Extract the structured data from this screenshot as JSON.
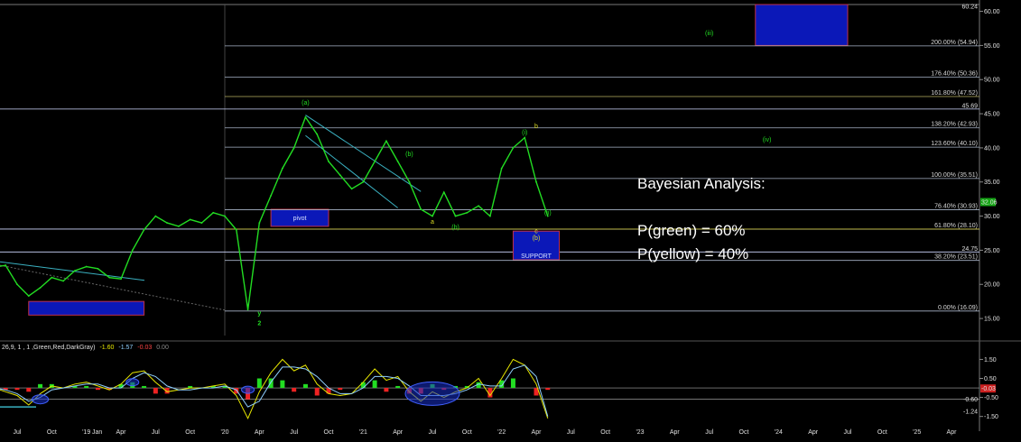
{
  "chart_data": [
    {
      "type": "line",
      "chart": "price",
      "y_axis": {
        "ylim": [
          12.5,
          61.0
        ],
        "ticks": [
          "60.00",
          "55.00",
          "50.00",
          "45.00",
          "40.00",
          "35.00",
          "30.00",
          "25.00",
          "20.00",
          "15.00"
        ],
        "tick_values": [
          60,
          55,
          50,
          45,
          40,
          35,
          30,
          25,
          20,
          15
        ],
        "price_tags": [
          {
            "text": "60.24",
            "value": 60.24
          },
          {
            "text": "45.69",
            "value": 45.69
          },
          {
            "text": "32.06",
            "value": 32.06
          },
          {
            "text": "24.75",
            "value": 24.75
          }
        ]
      },
      "x_axis": {
        "ticks": [
          "Jul",
          "Oct",
          "'19",
          "Jan",
          "Apr",
          "Jul",
          "Oct",
          "'20",
          "Apr",
          "Jul",
          "Oct",
          "'21",
          "Apr",
          "Jul",
          "Oct",
          "'22",
          "Apr",
          "Jul",
          "Oct",
          "'23",
          "Apr",
          "Jul",
          "Oct",
          "'24",
          "Apr",
          "Jul",
          "Oct",
          "'25",
          "Apr"
        ],
        "tick_dates": [
          "2018-07",
          "2018-10",
          "2019-01",
          "2019-01",
          "2019-04",
          "2019-07",
          "2019-10",
          "2020-01",
          "2020-04",
          "2020-07",
          "2020-10",
          "2021-01",
          "2021-04",
          "2021-07",
          "2021-10",
          "2022-01",
          "2022-04",
          "2022-07",
          "2022-10",
          "2023-01",
          "2023-04",
          "2023-07",
          "2023-10",
          "2024-01",
          "2024-04",
          "2024-07",
          "2024-10",
          "2025-01",
          "2025-04"
        ]
      },
      "series": [
        {
          "color": "#22dd22",
          "x": [
            "2018-05",
            "2018-06",
            "2018-07",
            "2018-08",
            "2018-09",
            "2018-10",
            "2018-11",
            "2018-12",
            "2019-01",
            "2019-02",
            "2019-03",
            "2019-04",
            "2019-05",
            "2019-06",
            "2019-07",
            "2019-08",
            "2019-09",
            "2019-10",
            "2019-11",
            "2019-12",
            "2020-01",
            "2020-02",
            "2020-03",
            "2020-04",
            "2020-05",
            "2020-06",
            "2020-07",
            "2020-08",
            "2020-09",
            "2020-10",
            "2020-11",
            "2020-12",
            "2021-01",
            "2021-02",
            "2021-03",
            "2021-04",
            "2021-05",
            "2021-06",
            "2021-07",
            "2021-08",
            "2021-09",
            "2021-10",
            "2021-11",
            "2021-12",
            "2022-01",
            "2022-02",
            "2022-03",
            "2022-04",
            "2022-05"
          ],
          "y": [
            22.5,
            22.8,
            20.0,
            18.3,
            19.5,
            21.0,
            20.5,
            22.0,
            22.6,
            22.3,
            21.0,
            20.8,
            25.0,
            28.0,
            30.0,
            29.0,
            28.5,
            29.5,
            29.0,
            30.5,
            30.0,
            28.0,
            16.3,
            29.0,
            33.0,
            37.0,
            40.0,
            44.5,
            42.0,
            38.0,
            36.0,
            34.0,
            35.0,
            38.0,
            41.0,
            38.0,
            35.0,
            31.0,
            30.0,
            33.5,
            30.0,
            30.5,
            31.5,
            30.0,
            37.0,
            40.0,
            41.5,
            35.0,
            30.0
          ]
        }
      ],
      "fib_levels": [
        {
          "label": "200.00% (54.94)",
          "value": 54.94
        },
        {
          "label": "176.40% (50.36)",
          "value": 50.36
        },
        {
          "label": "161.80% (47.52)",
          "value": 47.52
        },
        {
          "label": "138.20% (42.93)",
          "value": 42.93
        },
        {
          "label": "123.60% (40.10)",
          "value": 40.1
        },
        {
          "label": "100.00% (35.51)",
          "value": 35.51
        },
        {
          "label": "76.40% (30.93)",
          "value": 30.93
        },
        {
          "label": "61.80% (28.10)",
          "value": 28.1
        },
        {
          "label": "38.20% (23.51)",
          "value": 23.51
        },
        {
          "label": "0.00% (16.09)",
          "value": 16.09
        }
      ],
      "wave_labels": [
        {
          "text": "(a)",
          "x": "2020-08",
          "y": 46.3,
          "color": "#22dd22"
        },
        {
          "text": "(b)",
          "x": "2021-05",
          "y": 38.8,
          "color": "#22dd22"
        },
        {
          "text": "(i)",
          "x": "2022-03",
          "y": 42.0,
          "color": "#22dd22"
        },
        {
          "text": "b",
          "x": "2022-04",
          "y": 42.9,
          "color": "#dddd22"
        },
        {
          "text": "(ii)",
          "x": "2022-05",
          "y": 30.2,
          "color": "#22dd22"
        },
        {
          "text": "a",
          "x": "2021-07",
          "y": 28.9,
          "color": "#dddd22"
        },
        {
          "text": "(b)",
          "x": "2021-09",
          "y": 28.1,
          "color": "#22dd22"
        },
        {
          "text": "c",
          "x": "2022-04",
          "y": 27.5,
          "color": "#dddd22"
        },
        {
          "text": "(b)",
          "x": "2022-04",
          "y": 26.5,
          "color": "#dddd22"
        },
        {
          "text": "(iii)",
          "x": "2023-07",
          "y": 56.5,
          "color": "#22dd22"
        },
        {
          "text": "(iv)",
          "x": "2023-12",
          "y": 40.9,
          "color": "#22dd22"
        },
        {
          "text": "y",
          "x": "2020-04",
          "y": 15.5,
          "color": "#22dd22"
        },
        {
          "text": "2",
          "x": "2020-04",
          "y": 14.0,
          "color": "#22dd22"
        }
      ],
      "zones": [
        {
          "label": "pivot",
          "x0": "2020-05",
          "x1": "2020-10",
          "y0": 28.5,
          "y1": 31.0
        },
        {
          "label": "SUPPORT",
          "x0": "2022-02",
          "x1": "2022-06",
          "y0": 23.6,
          "y1": 27.8
        },
        {
          "label": "",
          "x0": "2023-11",
          "x1": "2024-07",
          "y0": 55.0,
          "y1": 61.0
        },
        {
          "label": "",
          "x0": "2018-08",
          "x1": "2019-06",
          "y0": 15.5,
          "y1": 17.5
        }
      ],
      "annotation": {
        "title": "Bayesian Analysis:",
        "lines": [
          "P(green) = 60%",
          "P(yellow) = 40%"
        ]
      }
    },
    {
      "type": "line",
      "chart": "indicator",
      "settings": {
        "text": "26,9, 1 , 1 ,Green,Red,DarkGray)",
        "values": [
          {
            "text": "-1.60",
            "color": "#e8e800"
          },
          {
            "text": "-1.57",
            "color": "#8fd0ff"
          },
          {
            "text": "-0.03",
            "color": "#ff4444"
          },
          {
            "text": "0.00",
            "color": "#888888"
          }
        ]
      },
      "y_axis": {
        "ylim": [
          -1.8,
          1.9
        ],
        "ticks": [
          "1.50",
          "0.50",
          "-0.50",
          "-1.50"
        ],
        "tick_values": [
          1.5,
          0.5,
          -0.5,
          -1.5
        ],
        "price_tags": [
          {
            "text": "-0.03",
            "value": -0.03
          },
          {
            "text": "-0.60",
            "value": -0.6
          },
          {
            "text": "-1.24",
            "value": -1.24
          }
        ]
      },
      "series": [
        {
          "color": "#e8e800",
          "x": [
            "2018-05",
            "2018-06",
            "2018-07",
            "2018-08",
            "2018-09",
            "2018-10",
            "2018-11",
            "2018-12",
            "2019-01",
            "2019-02",
            "2019-03",
            "2019-04",
            "2019-05",
            "2019-06",
            "2019-07",
            "2019-08",
            "2019-09",
            "2019-10",
            "2019-11",
            "2019-12",
            "2020-01",
            "2020-02",
            "2020-03",
            "2020-04",
            "2020-05",
            "2020-06",
            "2020-07",
            "2020-08",
            "2020-09",
            "2020-10",
            "2020-11",
            "2020-12",
            "2021-01",
            "2021-02",
            "2021-03",
            "2021-04",
            "2021-05",
            "2021-06",
            "2021-07",
            "2021-08",
            "2021-09",
            "2021-10",
            "2021-11",
            "2021-12",
            "2022-01",
            "2022-02",
            "2022-03",
            "2022-04",
            "2022-05"
          ],
          "y": [
            0.0,
            -0.2,
            -0.4,
            -0.9,
            -0.3,
            0.1,
            0.0,
            0.2,
            0.3,
            0.1,
            -0.1,
            0.2,
            0.8,
            0.9,
            0.3,
            -0.2,
            -0.1,
            0.0,
            0.0,
            0.1,
            0.2,
            -0.4,
            -1.6,
            -0.2,
            0.8,
            1.5,
            0.9,
            1.2,
            0.2,
            -0.3,
            -0.4,
            -0.3,
            0.3,
            1.0,
            0.4,
            0.6,
            -0.2,
            -0.7,
            -0.2,
            -0.5,
            -0.2,
            0.0,
            0.5,
            -0.4,
            0.5,
            1.5,
            1.2,
            0.2,
            -1.6
          ]
        },
        {
          "color": "#8fd0ff",
          "x": [
            "2018-05",
            "2018-06",
            "2018-07",
            "2018-08",
            "2018-09",
            "2018-10",
            "2018-11",
            "2018-12",
            "2019-01",
            "2019-02",
            "2019-03",
            "2019-04",
            "2019-05",
            "2019-06",
            "2019-07",
            "2019-08",
            "2019-09",
            "2019-10",
            "2019-11",
            "2019-12",
            "2020-01",
            "2020-02",
            "2020-03",
            "2020-04",
            "2020-05",
            "2020-06",
            "2020-07",
            "2020-08",
            "2020-09",
            "2020-10",
            "2020-11",
            "2020-12",
            "2021-01",
            "2021-02",
            "2021-03",
            "2021-04",
            "2021-05",
            "2021-06",
            "2021-07",
            "2021-08",
            "2021-09",
            "2021-10",
            "2021-11",
            "2021-12",
            "2022-01",
            "2022-02",
            "2022-03",
            "2022-04",
            "2022-05"
          ],
          "y": [
            0.0,
            -0.1,
            -0.3,
            -0.7,
            -0.5,
            -0.1,
            0.0,
            0.1,
            0.2,
            0.2,
            0.0,
            0.0,
            0.5,
            0.8,
            0.6,
            0.1,
            -0.1,
            -0.1,
            0.0,
            0.0,
            0.1,
            -0.1,
            -1.0,
            -0.7,
            0.3,
            1.1,
            1.1,
            1.0,
            0.6,
            0.0,
            -0.3,
            -0.3,
            0.0,
            0.6,
            0.6,
            0.5,
            0.1,
            -0.4,
            -0.4,
            -0.4,
            -0.3,
            -0.1,
            0.2,
            0.1,
            0.1,
            1.0,
            1.2,
            0.6,
            -1.5
          ]
        }
      ]
    }
  ]
}
